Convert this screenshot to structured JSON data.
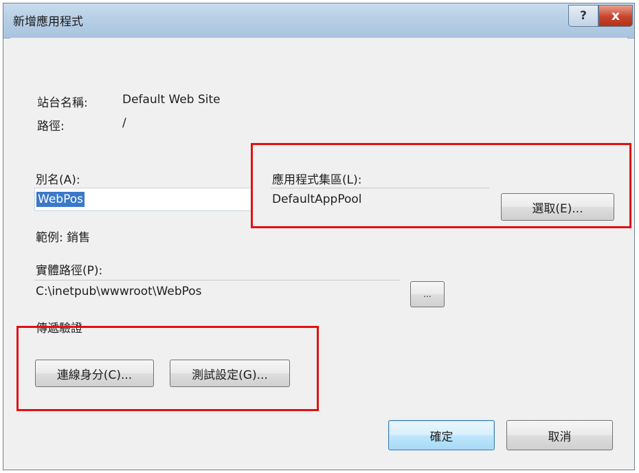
{
  "window": {
    "title": "新增應用程式",
    "help_glyph": "?",
    "close_glyph": "x"
  },
  "site": {
    "name_label": "站台名稱:",
    "name_value": "Default Web Site",
    "path_label": "路徑:",
    "path_value": "/"
  },
  "alias": {
    "label": "別名(A):",
    "value": "WebPos",
    "example": "範例: 銷售"
  },
  "app_pool": {
    "label": "應用程式集區(L):",
    "value": "DefaultAppPool",
    "select_button": "選取(E)..."
  },
  "physical_path": {
    "label": "實體路徑(P):",
    "value": "C:\\inetpub\\wwwroot\\WebPos",
    "browse_button": "..."
  },
  "pass_through": {
    "label": "傳遞驗證",
    "connect_as_button": "連線身分(C)...",
    "test_settings_button": "測試設定(G)..."
  },
  "footer": {
    "ok_button": "確定",
    "cancel_button": "取消"
  },
  "colors": {
    "highlight_box": "#e01010",
    "selection": "#3a78c9",
    "titlebar": "#b7cfe6"
  }
}
